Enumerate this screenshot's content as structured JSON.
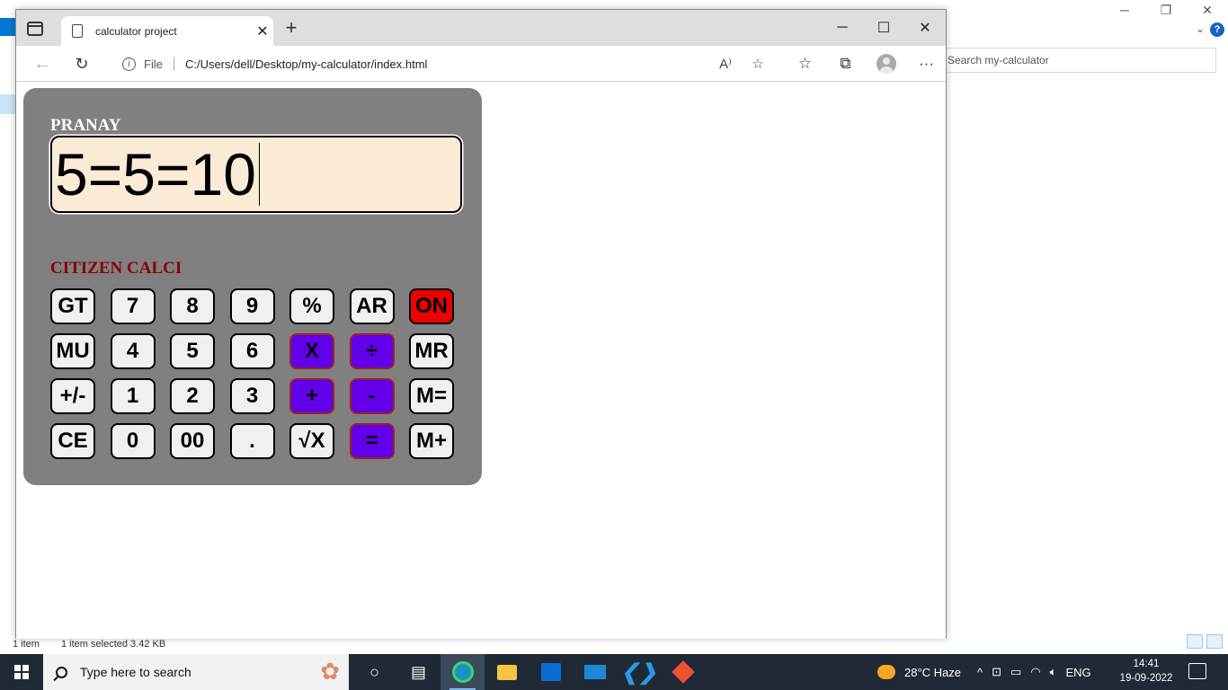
{
  "explorer": {
    "search_placeholder": "Search my-calculator",
    "status_items": "1 item",
    "status_selected": "1 item selected  3.42 KB",
    "help_label": "?",
    "window_controls": [
      "─",
      "❐",
      "✕"
    ]
  },
  "browser": {
    "tab_title": "calculator project",
    "tab_close": "✕",
    "new_tab": "+",
    "window_controls": [
      "─",
      "☐",
      "✕"
    ],
    "back": "←",
    "refresh": "↻",
    "info": "i",
    "file_label": "File",
    "url": "C:/Users/dell/Desktop/my-calculator/index.html",
    "read_aloud": "A⁾",
    "add_favorite": "☆",
    "favorites": "☆",
    "collections": "⧉",
    "more": "···"
  },
  "calculator": {
    "brand": "PRANAY",
    "display_value": "5=5=10",
    "model": "CITIZEN CALCI",
    "keys": [
      [
        "GT",
        "7",
        "8",
        "9",
        "%",
        "AR",
        "ON"
      ],
      [
        "MU",
        "4",
        "5",
        "6",
        "X",
        "÷",
        "MR"
      ],
      [
        "+/-",
        "1",
        "2",
        "3",
        "+",
        "-",
        "M="
      ],
      [
        "CE",
        "0",
        "00",
        ".",
        "√X",
        "=",
        "M+"
      ]
    ],
    "colors": {
      "body": "#808080",
      "display_bg": "#faebd7",
      "brand_text": "#ffffff",
      "model_text": "#8b0000",
      "operator_key": "#6200ea",
      "on_key": "#ee0000",
      "default_key": "#f0f0f0"
    }
  },
  "taskbar": {
    "search_placeholder": "Type here to search",
    "apps": [
      "task-view",
      "edge",
      "file-explorer",
      "store",
      "mail",
      "vscode",
      "git"
    ],
    "weather": "28°C  Haze",
    "tray_arrow": "^",
    "language": "ENG",
    "time": "14:41",
    "date": "19-09-2022"
  }
}
